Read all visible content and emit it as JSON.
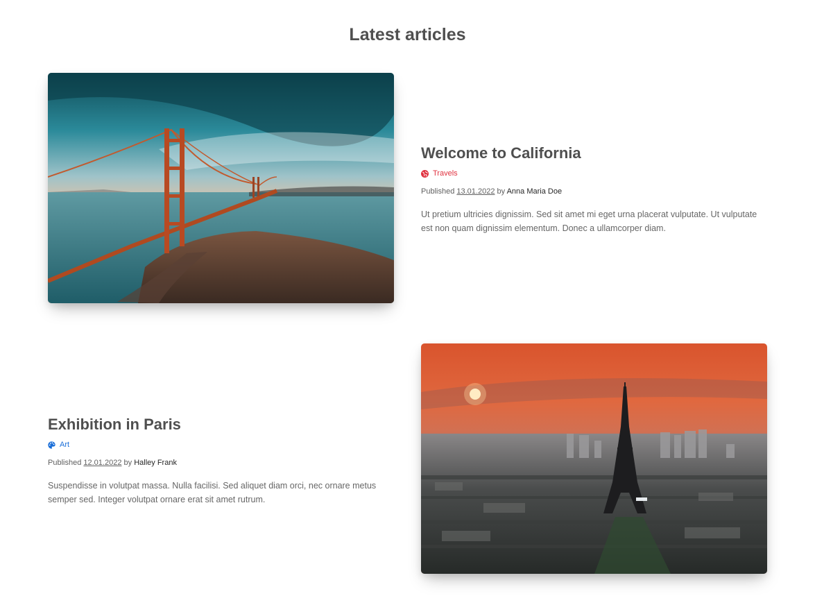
{
  "section": {
    "title": "Latest articles"
  },
  "articles": [
    {
      "title": "Welcome to California",
      "category": {
        "label": "Travels",
        "icon": "globe-icon",
        "color": "#e0313f"
      },
      "published_prefix": "Published",
      "date": "13.01.2022",
      "by": "by",
      "author": "Anna Maria Doe",
      "excerpt": "Ut pretium ultricies dignissim. Sed sit amet mi eget urna placerat vulputate. Ut vulputate est non quam dignissim elementum. Donec a ullamcorper diam.",
      "image": "golden-gate-bridge-photo"
    },
    {
      "title": "Exhibition in Paris",
      "category": {
        "label": "Art",
        "icon": "palette-icon",
        "color": "#1a6ed8"
      },
      "published_prefix": "Published",
      "date": "12.01.2022",
      "by": "by",
      "author": "Halley Frank",
      "excerpt": "Suspendisse in volutpat massa. Nulla facilisi. Sed aliquet diam orci, nec ornare metus semper sed. Integer volutpat ornare erat sit amet rutrum.",
      "image": "eiffel-tower-sunset-photo"
    }
  ]
}
